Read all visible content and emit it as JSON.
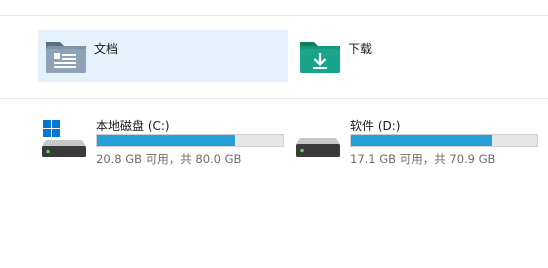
{
  "folders": [
    {
      "label": "文档",
      "icon": "documents-folder-icon",
      "selected": true
    },
    {
      "label": "下载",
      "icon": "downloads-folder-icon",
      "selected": false
    }
  ],
  "drives": [
    {
      "name": "本地磁盘 (C:)",
      "info": "20.8 GB 可用，共 80.0 GB",
      "used_fraction": 0.74,
      "icon": "system-drive-icon"
    },
    {
      "name": "软件 (D:)",
      "info": "17.1 GB 可用，共 70.9 GB",
      "used_fraction": 0.76,
      "icon": "hard-drive-icon"
    }
  ],
  "colors": {
    "bar_fill": "#26a0da",
    "selection": "#e5f1fb",
    "windows_blue": "#0078d4",
    "downloads_teal": "#1aa58a"
  }
}
